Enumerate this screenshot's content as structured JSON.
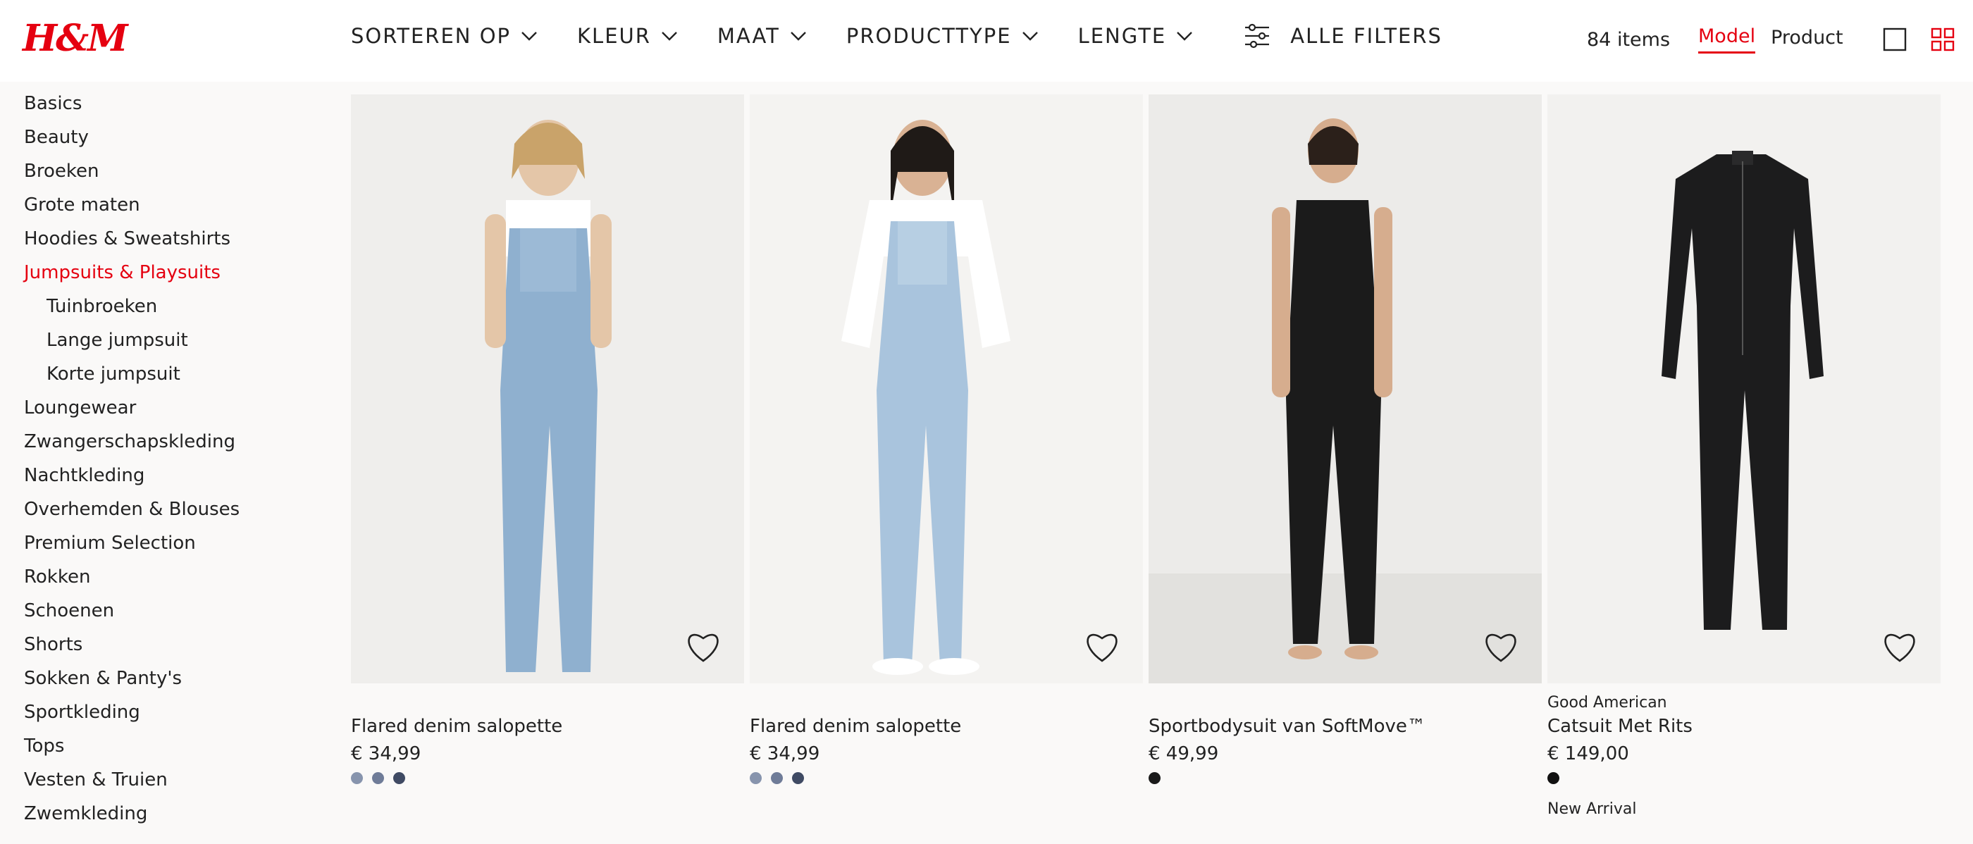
{
  "brand_logo": "H&M",
  "filters": [
    {
      "label": "SORTEREN OP"
    },
    {
      "label": "KLEUR"
    },
    {
      "label": "MAAT"
    },
    {
      "label": "PRODUCTTYPE"
    },
    {
      "label": "LENGTE"
    }
  ],
  "all_filters_label": "ALLE FILTERS",
  "item_count": "84 items",
  "view_tabs": {
    "model": "Model",
    "product": "Product"
  },
  "sidebar": {
    "items": [
      {
        "label": "Basics"
      },
      {
        "label": "Beauty"
      },
      {
        "label": "Broeken"
      },
      {
        "label": "Grote maten"
      },
      {
        "label": "Hoodies & Sweatshirts"
      },
      {
        "label": "Jumpsuits & Playsuits"
      },
      {
        "label": "Tuinbroeken"
      },
      {
        "label": "Lange jumpsuit"
      },
      {
        "label": "Korte jumpsuit"
      },
      {
        "label": "Loungewear"
      },
      {
        "label": "Zwangerschapskleding"
      },
      {
        "label": "Nachtkleding"
      },
      {
        "label": "Overhemden & Blouses"
      },
      {
        "label": "Premium Selection"
      },
      {
        "label": "Rokken"
      },
      {
        "label": "Schoenen"
      },
      {
        "label": "Shorts"
      },
      {
        "label": "Sokken & Panty's"
      },
      {
        "label": "Sportkleding"
      },
      {
        "label": "Tops"
      },
      {
        "label": "Vesten & Truien"
      },
      {
        "label": "Zwemkleding"
      }
    ]
  },
  "products": [
    {
      "brand": "",
      "name": "Flared denim salopette",
      "price": "€ 34,99",
      "swatches": [
        "#8794ad",
        "#6f7c98",
        "#3f4a63"
      ],
      "badge": ""
    },
    {
      "brand": "",
      "name": "Flared denim salopette",
      "price": "€ 34,99",
      "swatches": [
        "#8794ad",
        "#6f7c98",
        "#3f4a63"
      ],
      "badge": ""
    },
    {
      "brand": "",
      "name": "Sportbodysuit van SoftMove™",
      "price": "€ 49,99",
      "swatches": [
        "#1a1a1a"
      ],
      "badge": ""
    },
    {
      "brand": "Good American",
      "name": "Catsuit Met Rits",
      "price": "€ 149,00",
      "swatches": [
        "#111111"
      ],
      "badge": "New Arrival"
    }
  ],
  "colors": {
    "accent": "#e50010",
    "page_bg": "#faf9f8",
    "photo_bg": "#efeeec"
  }
}
